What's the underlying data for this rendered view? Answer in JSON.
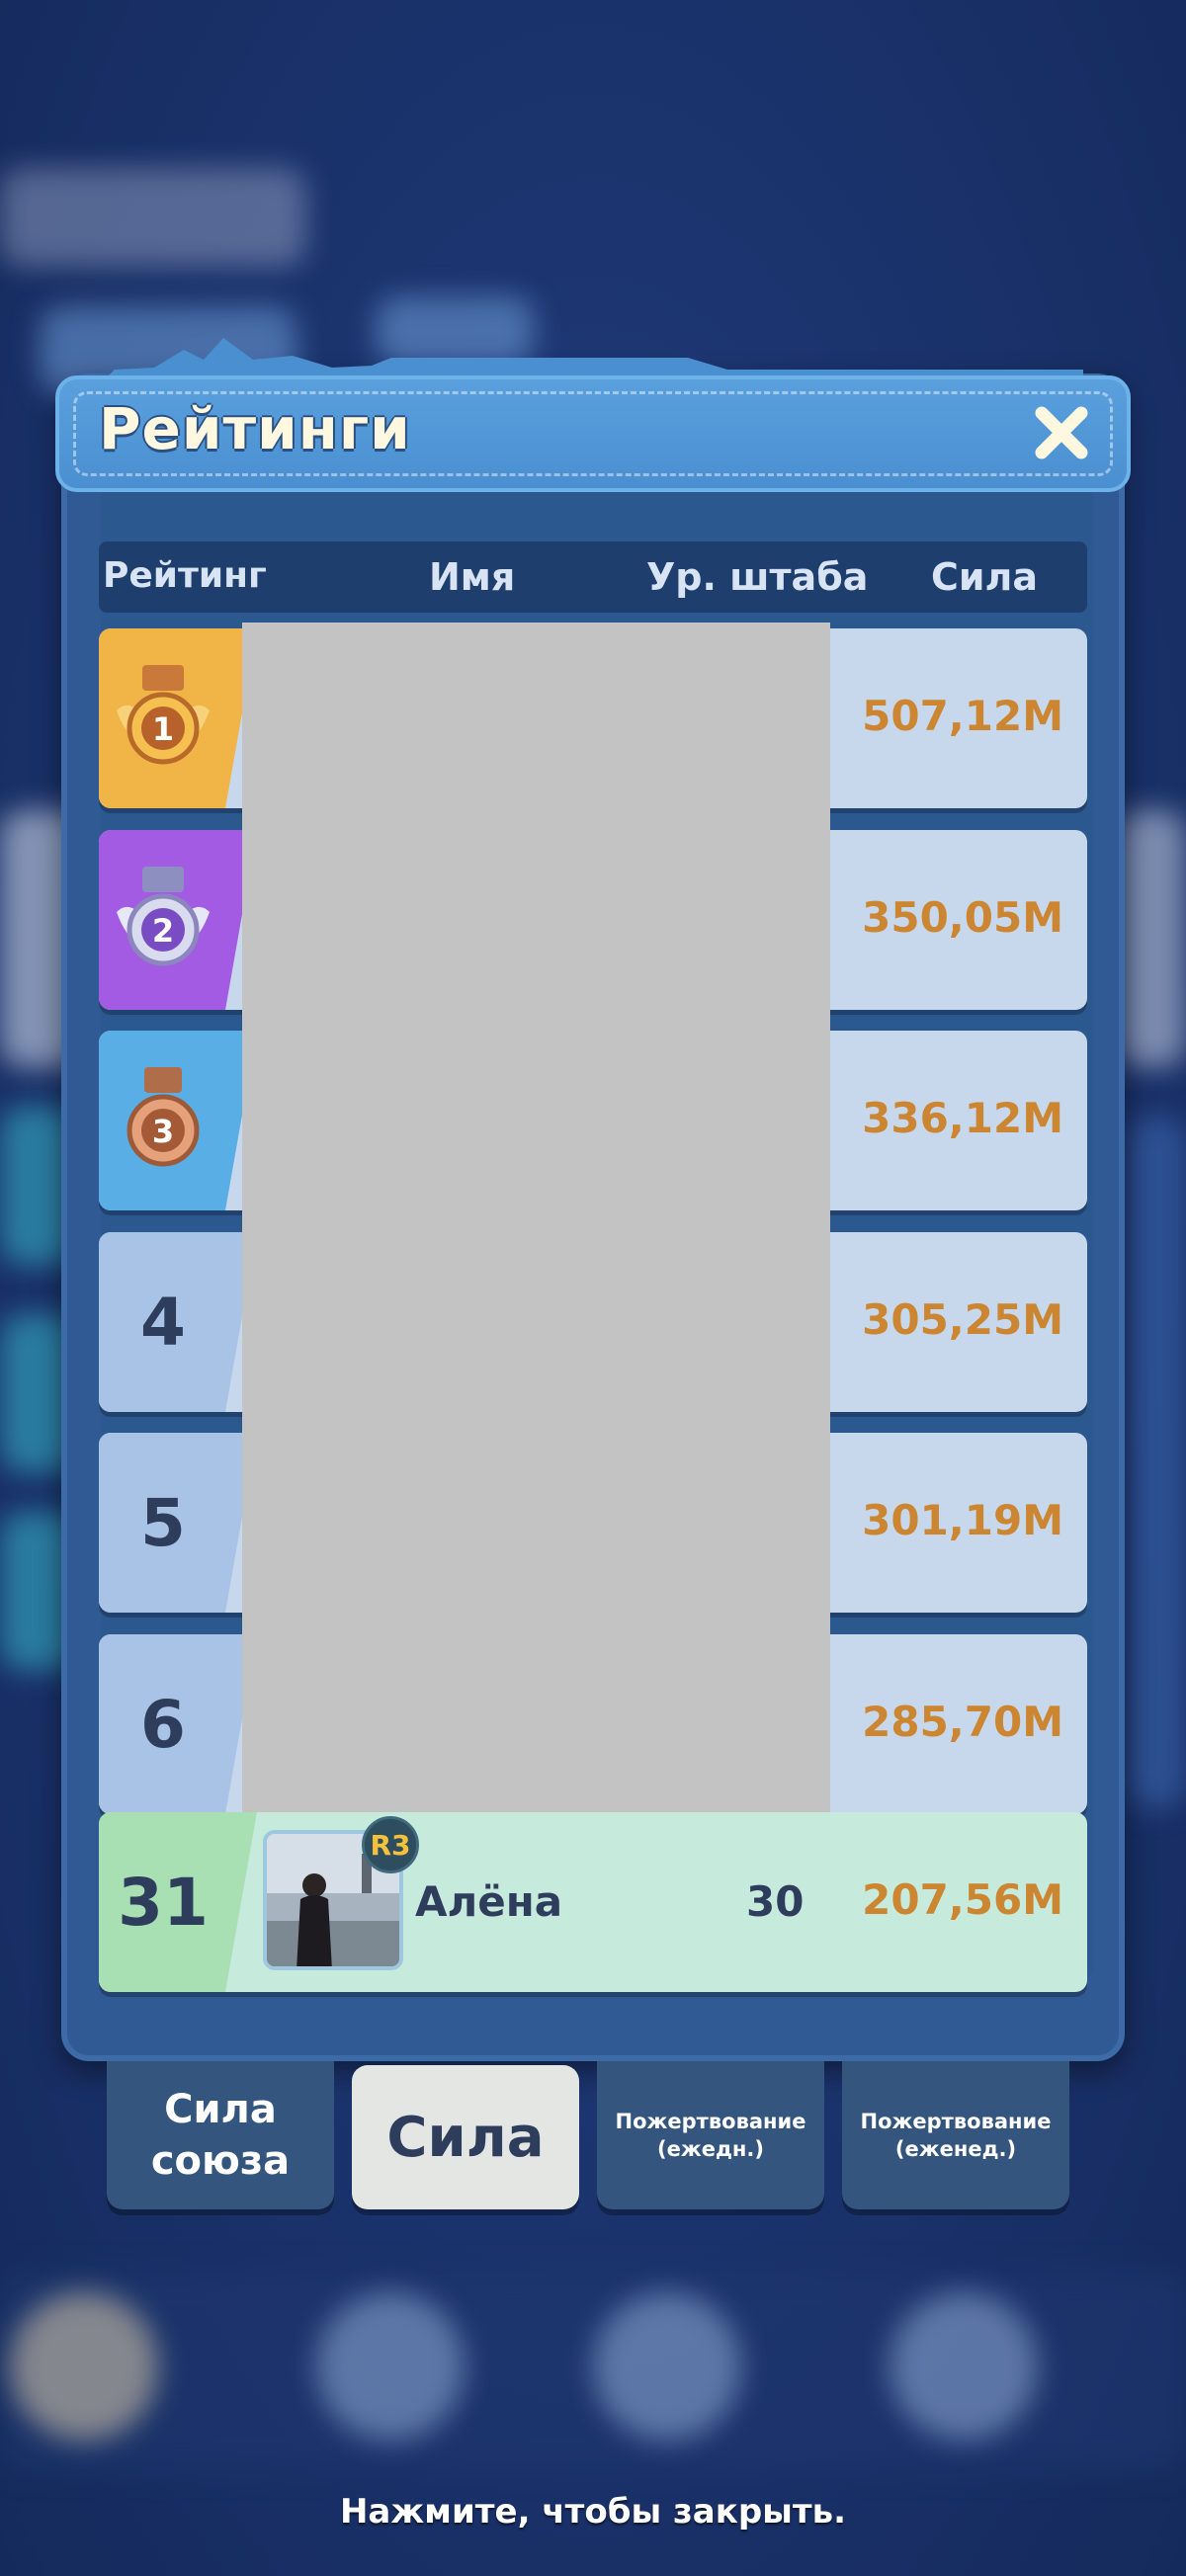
{
  "window": {
    "title": "Рейтинги"
  },
  "columns": {
    "rank": "Рейтинг",
    "name": "Имя",
    "hq_level": "Ур. штаба",
    "power": "Сила"
  },
  "rows": [
    {
      "rank": "1",
      "rank_style": "gold-medal",
      "power": "507,12M"
    },
    {
      "rank": "2",
      "rank_style": "silver-medal",
      "power": "350,05M"
    },
    {
      "rank": "3",
      "rank_style": "bronze-medal",
      "power": "336,12M"
    },
    {
      "rank": "4",
      "power": "305,25M"
    },
    {
      "rank": "5",
      "power": "301,19M"
    },
    {
      "rank": "6",
      "power": "285,70M"
    }
  ],
  "self_row": {
    "rank": "31",
    "badge": "R3",
    "name": "Алёна",
    "hq_level": "30",
    "power": "207,56M"
  },
  "tabs": [
    {
      "label_line1": "Сила",
      "label_line2": "союза",
      "active": false
    },
    {
      "label": "Сила",
      "active": true
    },
    {
      "label_line1": "Пожертвование",
      "label_line2": "(ежедн.)",
      "active": false
    },
    {
      "label_line1": "Пожертвование",
      "label_line2": "(еженед.)",
      "active": false
    }
  ],
  "footer_hint": "Нажмите, чтобы закрыть.",
  "colors": {
    "gold": "#f0b447",
    "silver": "#a45be3",
    "bronze": "#59aee6",
    "power_text": "#cc8530",
    "self_row": "#c6eadb",
    "panel": "#2f5a93"
  }
}
